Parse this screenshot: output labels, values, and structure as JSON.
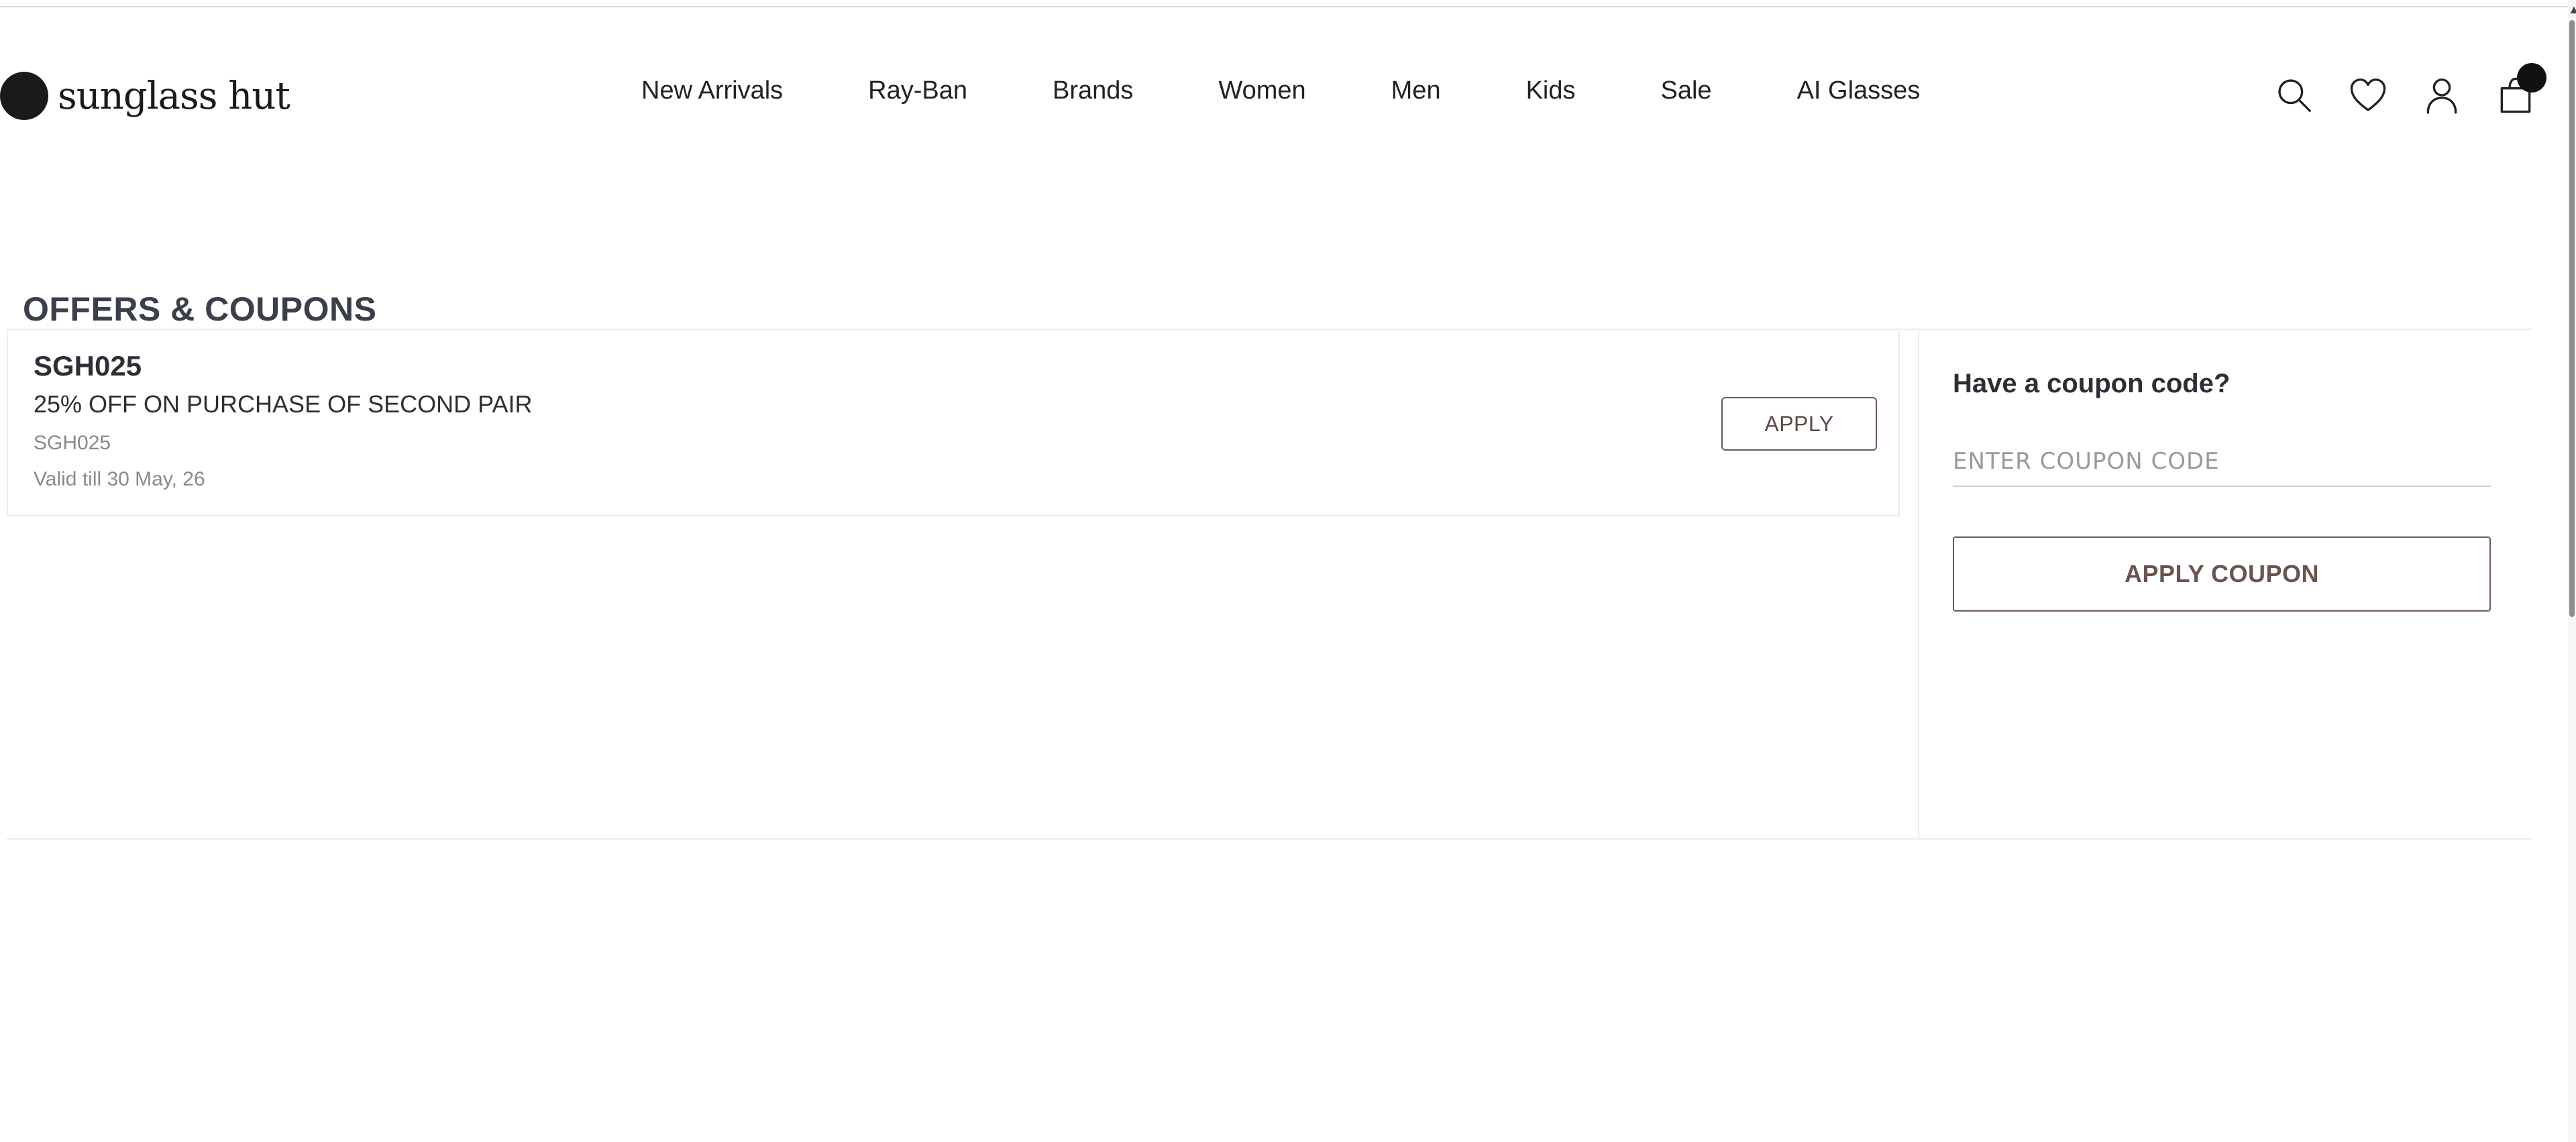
{
  "header": {
    "logo_text": "sunglass hut",
    "nav": [
      {
        "label": "New Arrivals"
      },
      {
        "label": "Ray-Ban"
      },
      {
        "label": "Brands"
      },
      {
        "label": "Women"
      },
      {
        "label": "Men"
      },
      {
        "label": "Kids"
      },
      {
        "label": "Sale"
      },
      {
        "label": "AI Glasses"
      }
    ],
    "icons": [
      "search-icon",
      "heart-icon",
      "account-icon",
      "bag-icon"
    ]
  },
  "page": {
    "title": "OFFERS & COUPONS"
  },
  "offers": [
    {
      "code": "SGH025",
      "description": "25% OFF ON PURCHASE OF SECOND PAIR",
      "subcode": "SGH025",
      "valid": "Valid till 30 May, 26",
      "button_label": "APPLY"
    }
  ],
  "coupon_panel": {
    "heading": "Have a coupon code?",
    "placeholder": "ENTER COUPON CODE",
    "value": "",
    "button_label": "APPLY COUPON"
  },
  "colors": {
    "accent_brown": "#6f5a56",
    "title_text": "#3a3f4a",
    "muted_text": "#8a8a8a",
    "border": "#ececec"
  }
}
